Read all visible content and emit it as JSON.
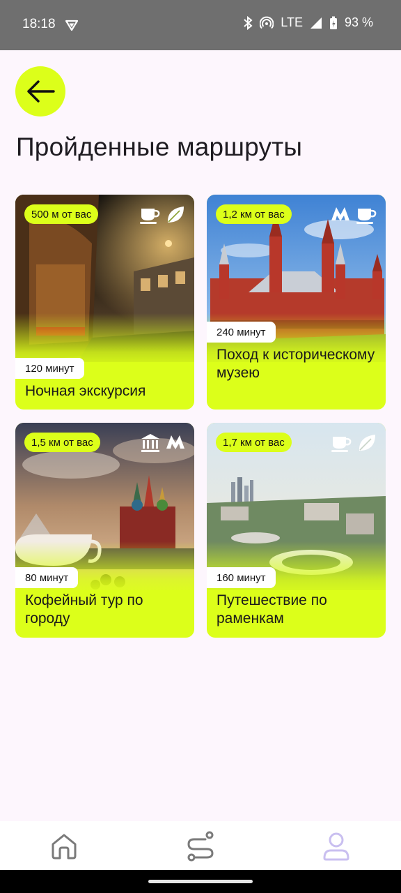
{
  "status_bar": {
    "time": "18:18",
    "network": "LTE",
    "battery": "93 %"
  },
  "header": {
    "back_icon": "arrow-left-icon",
    "title": "Пройденные маршруты"
  },
  "cards": [
    {
      "distance": "500 м от вас",
      "duration": "120 минут",
      "title": "Ночная экскурсия",
      "icons": [
        "coffee-cup-icon",
        "leaf-icon"
      ]
    },
    {
      "distance": "1,2 км от вас",
      "duration": "240 минут",
      "title": "Поход к историческому музею",
      "icons": [
        "metro-icon",
        "coffee-cup-icon"
      ]
    },
    {
      "distance": "1,5 км от вас",
      "duration": "80 минут",
      "title": "Кофейный тур по городу",
      "icons": [
        "museum-icon",
        "metro-icon"
      ]
    },
    {
      "distance": "1,7 км от вас",
      "duration": "160 минут",
      "title": "Путешествие по раменкам",
      "icons": [
        "coffee-cup-icon",
        "leaf-icon"
      ]
    }
  ],
  "bottom_nav": [
    {
      "icon": "home-icon",
      "active": false
    },
    {
      "icon": "route-icon",
      "active": false
    },
    {
      "icon": "profile-icon",
      "active": true
    }
  ],
  "colors": {
    "accent": "#dcff1a",
    "background": "#fdf6fd",
    "active_nav": "#c9bff0",
    "inactive_nav": "#7a7a7a"
  }
}
